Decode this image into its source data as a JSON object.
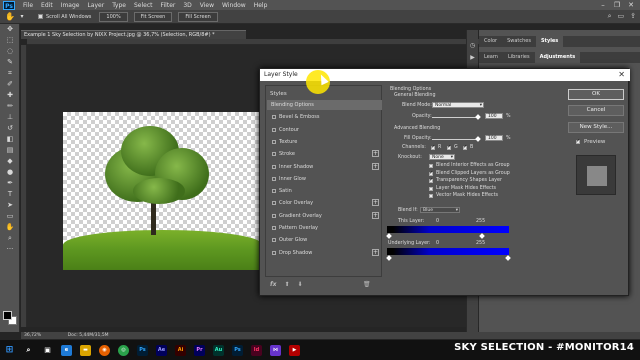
{
  "menubar": {
    "app_logo": "Ps",
    "items": [
      "File",
      "Edit",
      "Image",
      "Layer",
      "Type",
      "Select",
      "Filter",
      "3D",
      "View",
      "Window",
      "Help"
    ]
  },
  "options_bar": {
    "scroll_all": "Scroll All Windows",
    "zoom_value": "100%",
    "fit_screen": "Fit Screen",
    "fill_screen": "Fill Screen"
  },
  "document": {
    "tab_title": "Example 1 Sky Selection by NIXX Project.jpg @ 36,7% (Selection, RGB/8#) *",
    "status_zoom": "36,72%",
    "status_doc": "Doc: 5,44M/31,5M"
  },
  "right_panel": {
    "top_tabs": [
      "Color",
      "Swatches",
      "Styles"
    ],
    "sub_tabs": [
      "Learn",
      "Libraries",
      "Adjustments"
    ]
  },
  "dialog": {
    "title": "Layer Style",
    "styles_header": "Styles",
    "styles": [
      {
        "label": "Blending Options",
        "has_checkbox": false,
        "has_plus": false,
        "active": true
      },
      {
        "label": "Bevel & Emboss",
        "has_checkbox": true,
        "has_plus": false,
        "active": false
      },
      {
        "label": "Contour",
        "has_checkbox": true,
        "has_plus": false,
        "active": false
      },
      {
        "label": "Texture",
        "has_checkbox": true,
        "has_plus": false,
        "active": false
      },
      {
        "label": "Stroke",
        "has_checkbox": true,
        "has_plus": true,
        "active": false
      },
      {
        "label": "Inner Shadow",
        "has_checkbox": true,
        "has_plus": true,
        "active": false
      },
      {
        "label": "Inner Glow",
        "has_checkbox": true,
        "has_plus": false,
        "active": false
      },
      {
        "label": "Satin",
        "has_checkbox": true,
        "has_plus": false,
        "active": false
      },
      {
        "label": "Color Overlay",
        "has_checkbox": true,
        "has_plus": true,
        "active": false
      },
      {
        "label": "Gradient Overlay",
        "has_checkbox": true,
        "has_plus": true,
        "active": false
      },
      {
        "label": "Pattern Overlay",
        "has_checkbox": true,
        "has_plus": false,
        "active": false
      },
      {
        "label": "Outer Glow",
        "has_checkbox": true,
        "has_plus": false,
        "active": false
      },
      {
        "label": "Drop Shadow",
        "has_checkbox": true,
        "has_plus": true,
        "active": false
      }
    ],
    "blending": {
      "section": "Blending Options",
      "general": "General Blending",
      "blend_mode_label": "Blend Mode:",
      "blend_mode_value": "Normal",
      "opacity_label": "Opacity:",
      "opacity_value": "100",
      "pct": "%",
      "advanced": "Advanced Blending",
      "fill_opacity_label": "Fill Opacity:",
      "fill_opacity_value": "100",
      "channels_label": "Channels:",
      "channel_r": "R",
      "channel_g": "G",
      "channel_b": "B",
      "knockout_label": "Knockout:",
      "knockout_value": "None",
      "checks": [
        {
          "label": "Blend Interior Effects as Group",
          "checked": false
        },
        {
          "label": "Blend Clipped Layers as Group",
          "checked": true
        },
        {
          "label": "Transparency Shapes Layer",
          "checked": true
        },
        {
          "label": "Layer Mask Hides Effects",
          "checked": false
        },
        {
          "label": "Vector Mask Hides Effects",
          "checked": false
        }
      ],
      "blend_if_label": "Blend If:",
      "blend_if_value": "Blue",
      "this_layer_label": "This Layer:",
      "this_layer_min": "0",
      "this_layer_max": "255",
      "underlying_label": "Underlying Layer:",
      "underlying_min": "0",
      "underlying_max": "255"
    },
    "buttons": {
      "ok": "OK",
      "cancel": "Cancel",
      "new_style": "New Style...",
      "preview": "Preview"
    }
  },
  "taskbar": {
    "apps": [
      "Ps",
      "Ae",
      "Ai",
      "Pr",
      "Au",
      "Ps",
      "Id"
    ],
    "brand": "SKY SELECTION - #MONITOR14"
  }
}
